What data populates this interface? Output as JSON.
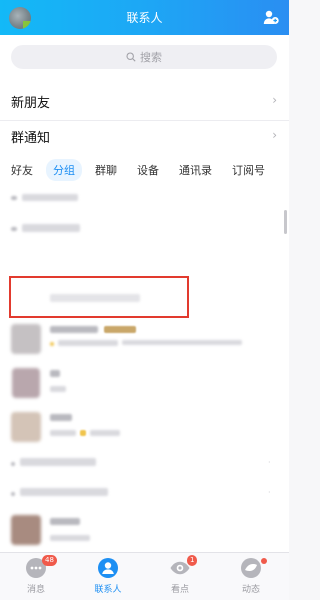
{
  "header": {
    "title": "联系人"
  },
  "search": {
    "placeholder": "搜索"
  },
  "rows": {
    "new_friends": "新朋友",
    "group_notice": "群通知"
  },
  "tabs": [
    "好友",
    "分组",
    "群聊",
    "设备",
    "通讯录",
    "订阅号"
  ],
  "active_tab": "分组",
  "bottom_nav": {
    "items": [
      {
        "label": "消息",
        "badge": "48"
      },
      {
        "label": "联系人",
        "badge": ""
      },
      {
        "label": "看点",
        "badge": "1"
      },
      {
        "label": "动态",
        "badge": ""
      }
    ]
  },
  "colors": {
    "header": "#1da7f5",
    "accent": "#1c8ef3",
    "highlight": "#e23a2e",
    "badge": "#f05a4b"
  }
}
